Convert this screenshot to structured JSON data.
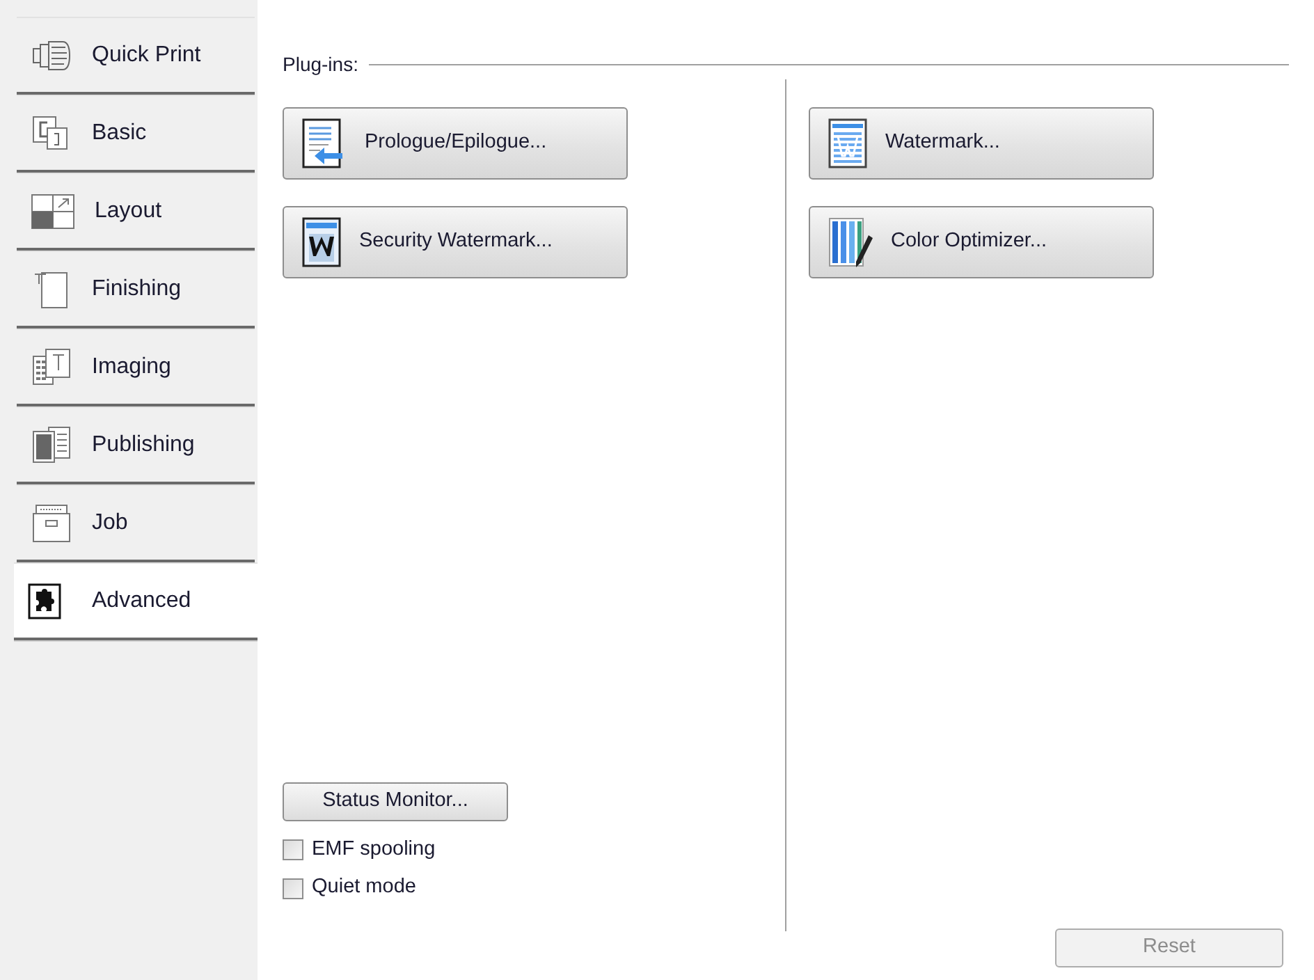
{
  "tabs": [
    {
      "label": "Quick Print",
      "selected": false
    },
    {
      "label": "Basic",
      "selected": false
    },
    {
      "label": "Layout",
      "selected": false
    },
    {
      "label": "Finishing",
      "selected": false
    },
    {
      "label": "Imaging",
      "selected": false
    },
    {
      "label": "Publishing",
      "selected": false
    },
    {
      "label": "Job",
      "selected": false
    },
    {
      "label": "Advanced",
      "selected": true
    }
  ],
  "plugins": {
    "heading": "Plug-ins:",
    "left_buttons": [
      {
        "label": "Prologue/Epilogue..."
      },
      {
        "label": "Security Watermark..."
      }
    ],
    "right_buttons": [
      {
        "label": "Watermark..."
      },
      {
        "label": "Color Optimizer..."
      }
    ]
  },
  "status_monitor_button": "Status Monitor...",
  "checkboxes": [
    {
      "label": "EMF spooling",
      "checked": false
    },
    {
      "label": "Quiet mode",
      "checked": false
    }
  ],
  "reset_button": {
    "label": "Reset",
    "disabled": true
  }
}
